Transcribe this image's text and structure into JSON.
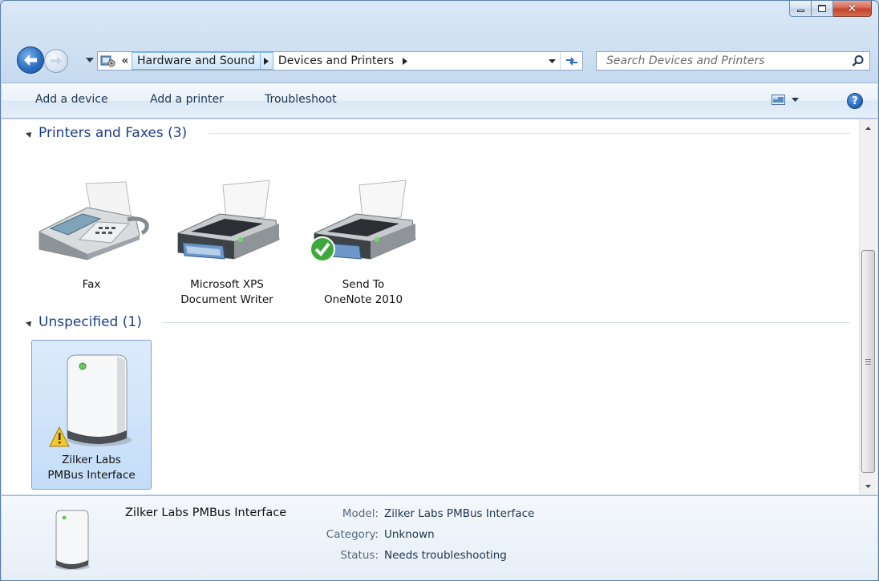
{
  "window": {
    "caption_buttons": [
      "minimize",
      "maximize",
      "close"
    ]
  },
  "navigation": {
    "breadcrumbs": [
      {
        "label": "Hardware and Sound"
      },
      {
        "label": "Devices and Printers"
      }
    ],
    "overflow_glyph": "«",
    "search": {
      "placeholder": "Search Devices and Printers"
    }
  },
  "commandbar": {
    "add_device": "Add a device",
    "add_printer": "Add a printer",
    "troubleshoot": "Troubleshoot"
  },
  "groups": [
    {
      "title": "Printers and Faxes (3)",
      "items": [
        {
          "label": "Fax",
          "icon": "fax-icon"
        },
        {
          "label": "Microsoft XPS\nDocument Writer",
          "icon": "printer-icon"
        },
        {
          "label": "Send To\nOneNote 2010",
          "icon": "printer-icon",
          "badge": "default-check-icon"
        }
      ]
    },
    {
      "title": "Unspecified (1)",
      "items": [
        {
          "label": "Zilker Labs\nPMBus Interface",
          "icon": "device-tower-icon",
          "badge": "warning-icon",
          "selected": true
        }
      ]
    }
  ],
  "details": {
    "name": "Zilker Labs PMBus Interface",
    "fields": [
      {
        "key": "Model:",
        "value": "Zilker Labs PMBus Interface"
      },
      {
        "key": "Category:",
        "value": "Unknown"
      },
      {
        "key": "Status:",
        "value": "Needs troubleshooting"
      }
    ]
  },
  "colors": {
    "accent": "#1e3d8c",
    "selection": "#c4ddf8",
    "close_button": "#c4432b"
  }
}
